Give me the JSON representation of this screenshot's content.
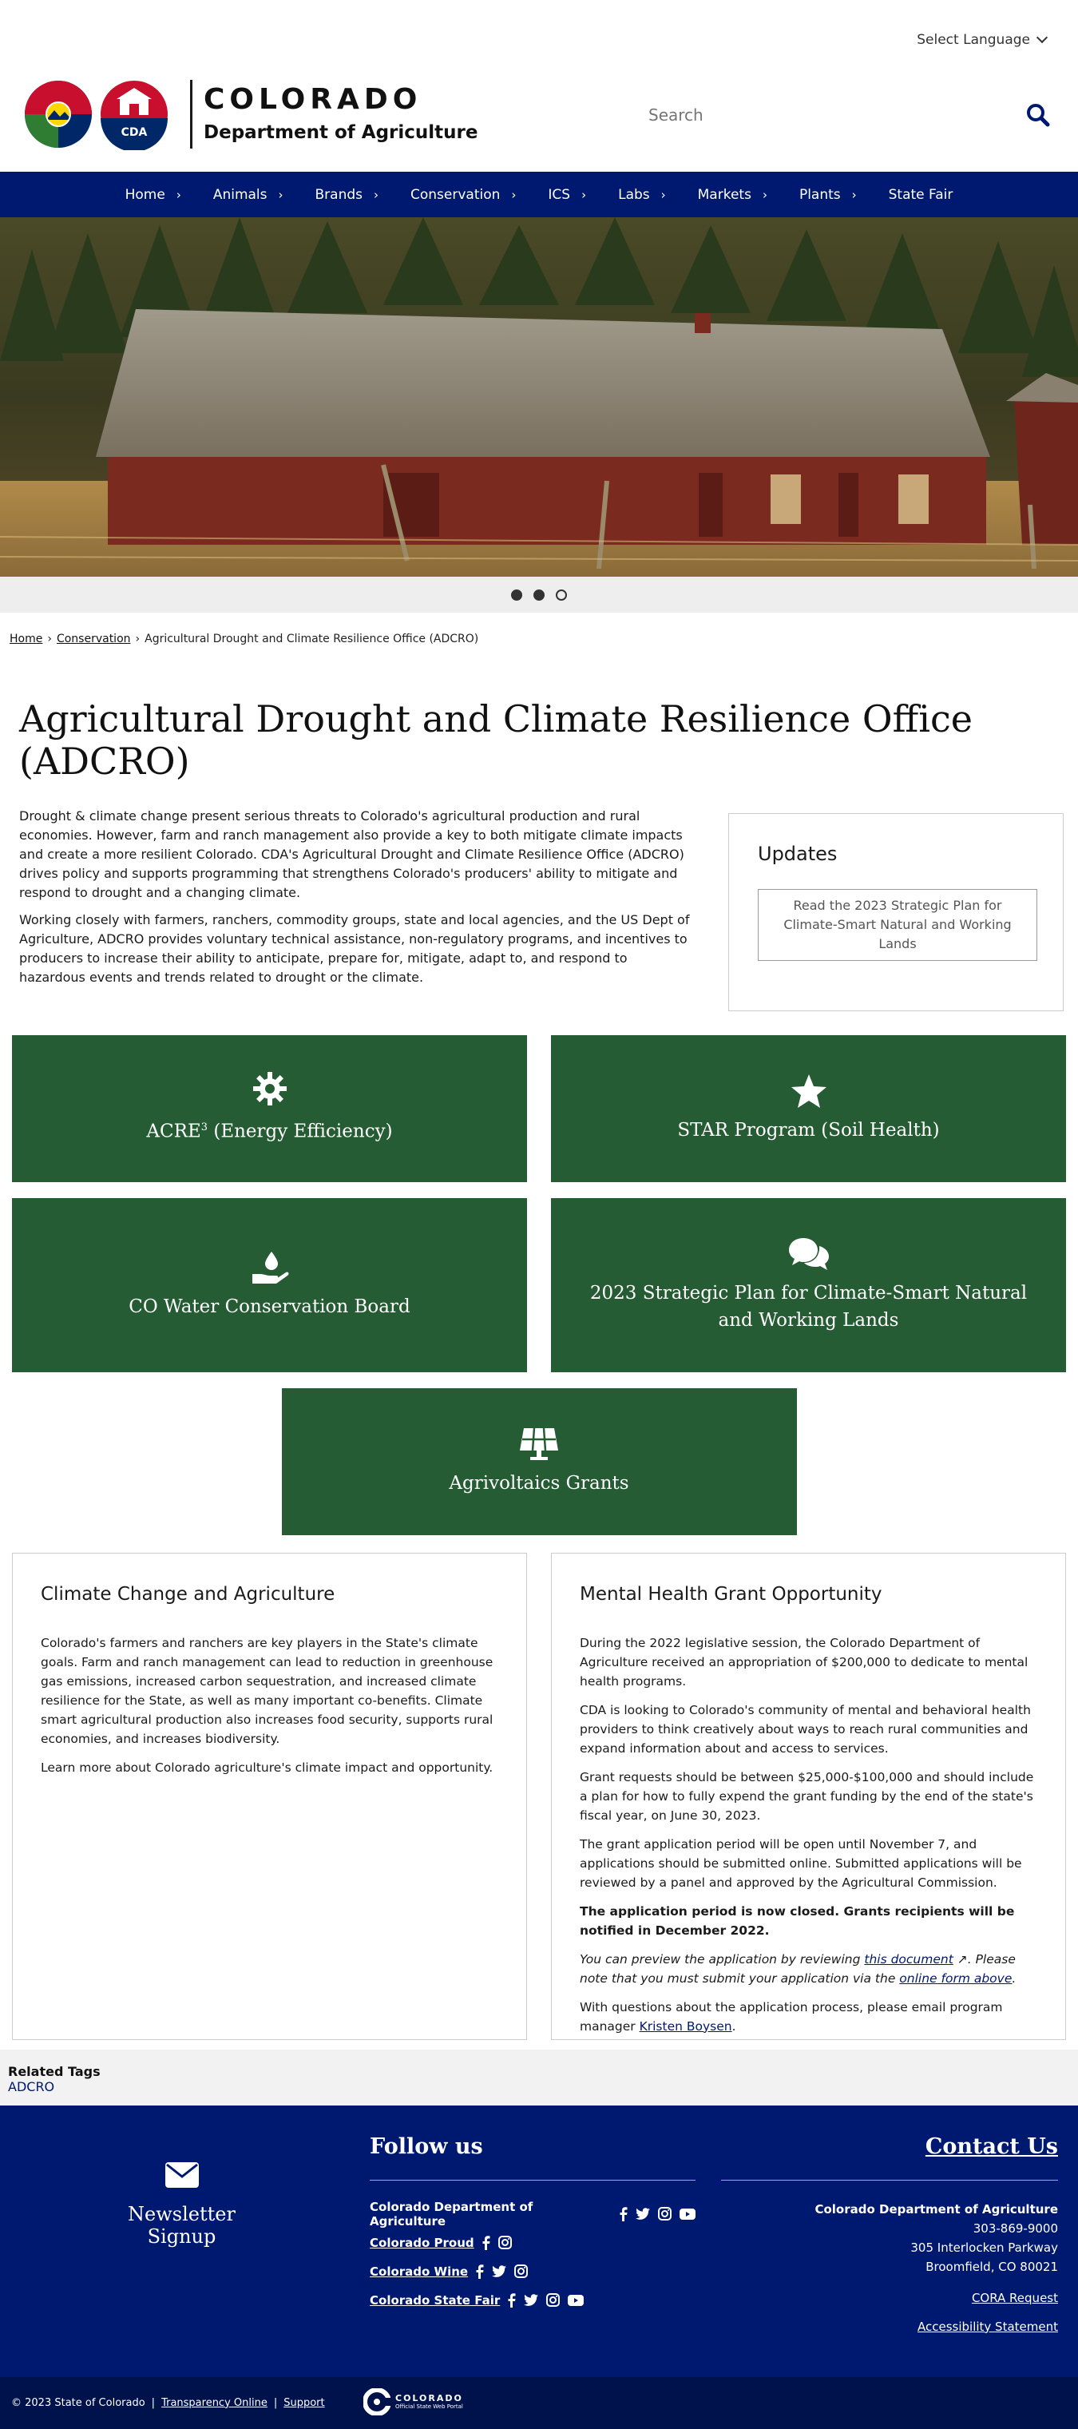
{
  "header": {
    "language_label": "Select Language",
    "brand_top": "COLORADO",
    "brand_bottom": "Department of Agriculture",
    "logo_badge": "CDA",
    "search_placeholder": "Search"
  },
  "nav": {
    "items": [
      "Home",
      "Animals",
      "Brands",
      "Conservation",
      "ICS",
      "Labs",
      "Markets",
      "Plants",
      "State Fair"
    ]
  },
  "carousel": {
    "slide_count": 3,
    "active_slide": 1
  },
  "breadcrumb": {
    "home": "Home",
    "section": "Conservation",
    "current": "Agricultural Drought and Climate Resilience Office (ADCRO)"
  },
  "page": {
    "title": "Agricultural Drought and Climate Resilience Office (ADCRO)",
    "intro_p1": "Drought & climate change present serious threats to Colorado's agricultural production and rural economies. However, farm and ranch management also provide a key to both mitigate climate impacts and create a more resilient Colorado. CDA's Agricultural Drought and Climate Resilience Office (ADCRO) drives policy and supports programming that strengthens Colorado's producers' ability to mitigate and respond to drought and a changing climate.",
    "intro_p2": "Working closely with farmers, ranchers, commodity groups, state and local agencies, and the US Dept of Agriculture, ADCRO provides voluntary technical assistance, non-regulatory programs, and incentives to producers to increase their ability to anticipate, prepare for, mitigate, adapt to, and respond to hazardous events and trends related to drought or the climate."
  },
  "updates": {
    "heading": "Updates",
    "link": "Read the 2023 Strategic Plan for Climate-Smart Natural and Working Lands"
  },
  "tiles": {
    "acre_label": "ACRE",
    "acre_sup": "3",
    "acre_rest": " (Energy Efficiency)",
    "star": "STAR Program (Soil Health)",
    "water": "CO Water Conservation Board",
    "plan": "2023 Strategic Plan for Climate-Smart Natural and Working Lands",
    "agrivoltaics": "Agrivoltaics Grants"
  },
  "climate_card": {
    "heading": "Climate Change and Agriculture",
    "p1": "Colorado's farmers and ranchers are key players in the State's climate goals. Farm and ranch management can lead to reduction in greenhouse gas emissions, increased carbon sequestration, and increased climate resilience for the State, as well as many important co-benefits. Climate smart agricultural production also increases food security, supports rural economies, and increases biodiversity.",
    "p2": "Learn more about Colorado agriculture's climate impact and opportunity."
  },
  "mental_card": {
    "heading": "Mental Health Grant Opportunity",
    "p1": "During the 2022 legislative session, the Colorado Department of Agriculture received an appropriation of $200,000 to dedicate to mental health programs.",
    "p2": "CDA is looking to Colorado's community of mental and behavioral health providers to think creatively about ways to reach rural communities and expand information about and access to services.",
    "p3": "Grant requests should be between $25,000-$100,000 and should include a plan for how to fully expend the grant funding by the end of the state's fiscal year, on June 30, 2023.",
    "p4": "The grant application period will be open until November 7, and applications should be submitted online. Submitted applications will be reviewed by a panel and approved by the Agricultural Commission.",
    "p5": "The application period is now closed. Grants recipients will be notified in December 2022.",
    "p6a": "You can preview the application by reviewing ",
    "p6_link1": "this document",
    "p6b": ". Please note that you must submit your application via the ",
    "p6_link2": "online form above",
    "p6c": ".",
    "p7a": "With questions about the application process, please email program manager ",
    "p7_link": "Kristen Boysen",
    "p7b": "."
  },
  "related": {
    "heading": "Related Tags",
    "tag": "ADCRO"
  },
  "footer": {
    "newsletter": "Newsletter Signup",
    "follow_heading": "Follow us",
    "follow_rows": [
      "Colorado Department of Agriculture",
      "Colorado Proud",
      "Colorado Wine",
      "Colorado State Fair"
    ],
    "contact_heading": "Contact Us",
    "contact_org": "Colorado Department of Agriculture",
    "contact_phone": "303-869-9000",
    "contact_addr1": "305 Interlocken Parkway",
    "contact_addr2": "Broomfield, CO 80021",
    "cora": "CORA Request",
    "accessibility": "Accessibility Statement"
  },
  "bottom": {
    "copyright": "© 2023 State of Colorado",
    "transparency": "Transparency Online",
    "support": "Support",
    "portal_title": "COLORADO",
    "portal_sub": "Official State Web Portal"
  },
  "colors": {
    "navy": "#001970",
    "tile_green": "#255c33",
    "logo_red": "#c8102e"
  }
}
